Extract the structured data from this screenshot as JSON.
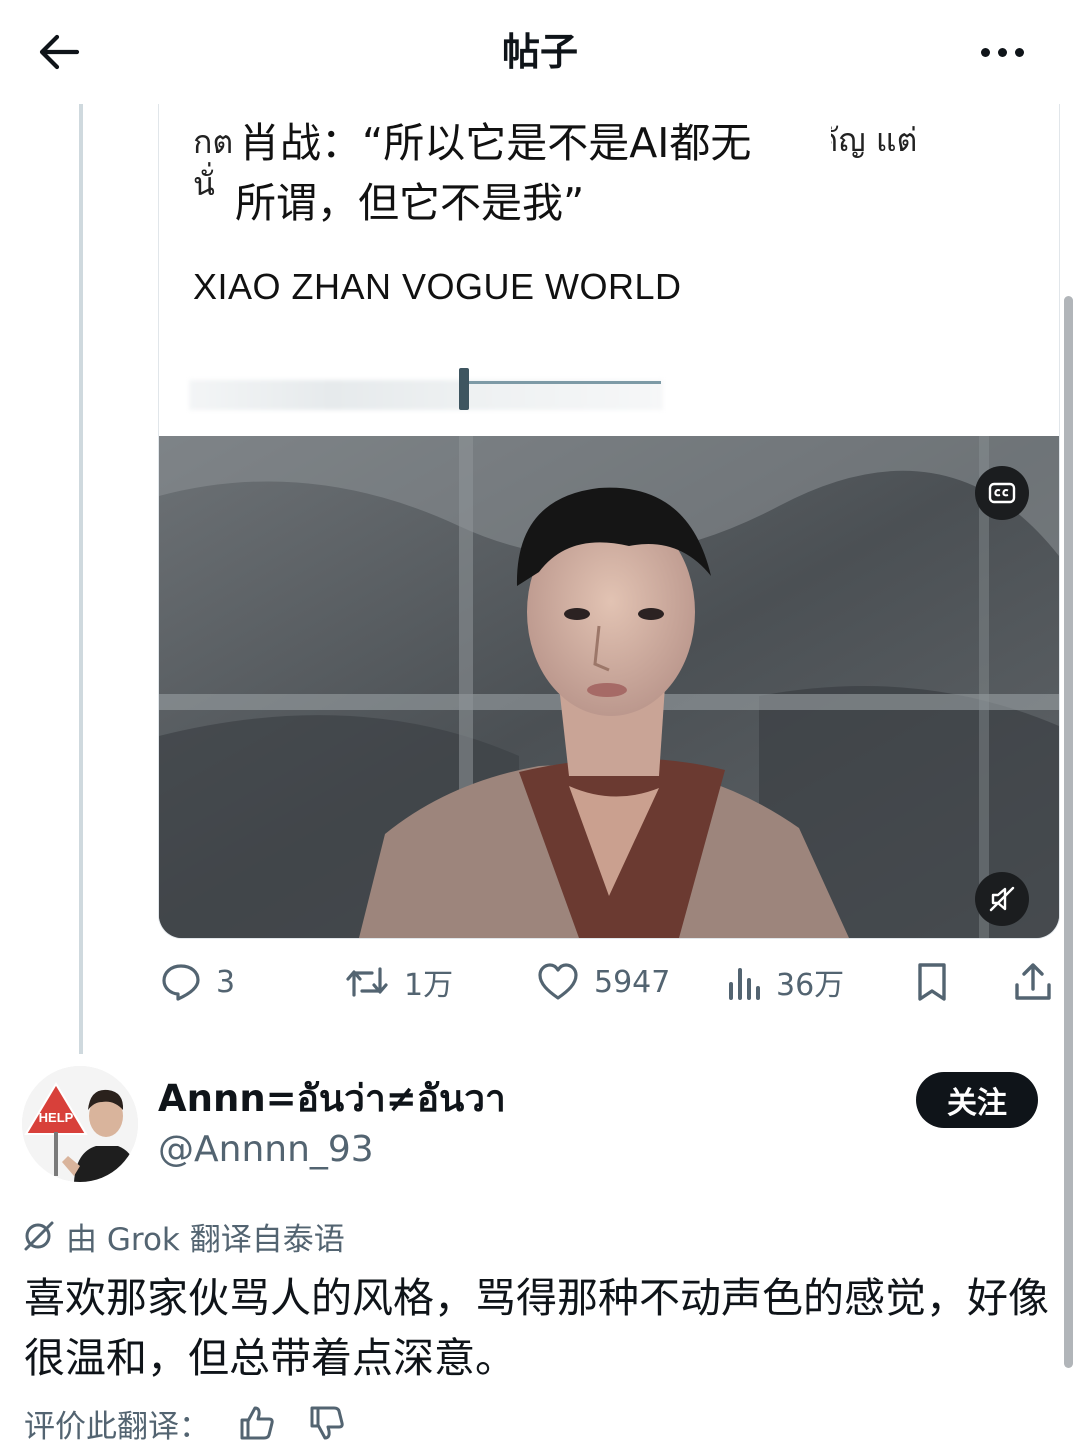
{
  "header": {
    "title": "帖子",
    "back_icon": "arrow-left-icon",
    "more_icon": "more-horizontal-icon"
  },
  "quoted_post": {
    "thai_line1": "กต",
    "thai_line2": "นั่",
    "thai_line3": "ำคัญ แต่",
    "quote_line1": "肖战：“所以它是不是AI都无",
    "quote_line2": "所谓，但它不是我”",
    "heading": "XIAO ZHAN VOGUE WORLD",
    "video": {
      "cc_icon": "closed-captions-icon",
      "mute_icon": "volume-muted-icon"
    }
  },
  "actions": {
    "replies": "3",
    "reposts": "1万",
    "likes": "5947",
    "views": "36万",
    "icons": [
      "reply-icon",
      "repost-icon",
      "like-icon",
      "views-icon",
      "bookmark-icon",
      "share-icon"
    ]
  },
  "reply": {
    "avatar_sign": "HELP",
    "display_name": "Annn=อันว่า≠อันวา",
    "handle": "@Annnn_93",
    "follow_label": "关注",
    "translated_note": "由 Grok 翻译自泰语",
    "body": "喜欢那家伙骂人的风格，骂得那种不动声色的感觉，好像很温和，但总带着点深意。",
    "rate_label": "评价此翻译："
  },
  "colors": {
    "text_primary": "#0f1419",
    "text_secondary": "#536471",
    "border": "#e1e6ea",
    "follow_button_bg": "#0f1419"
  }
}
